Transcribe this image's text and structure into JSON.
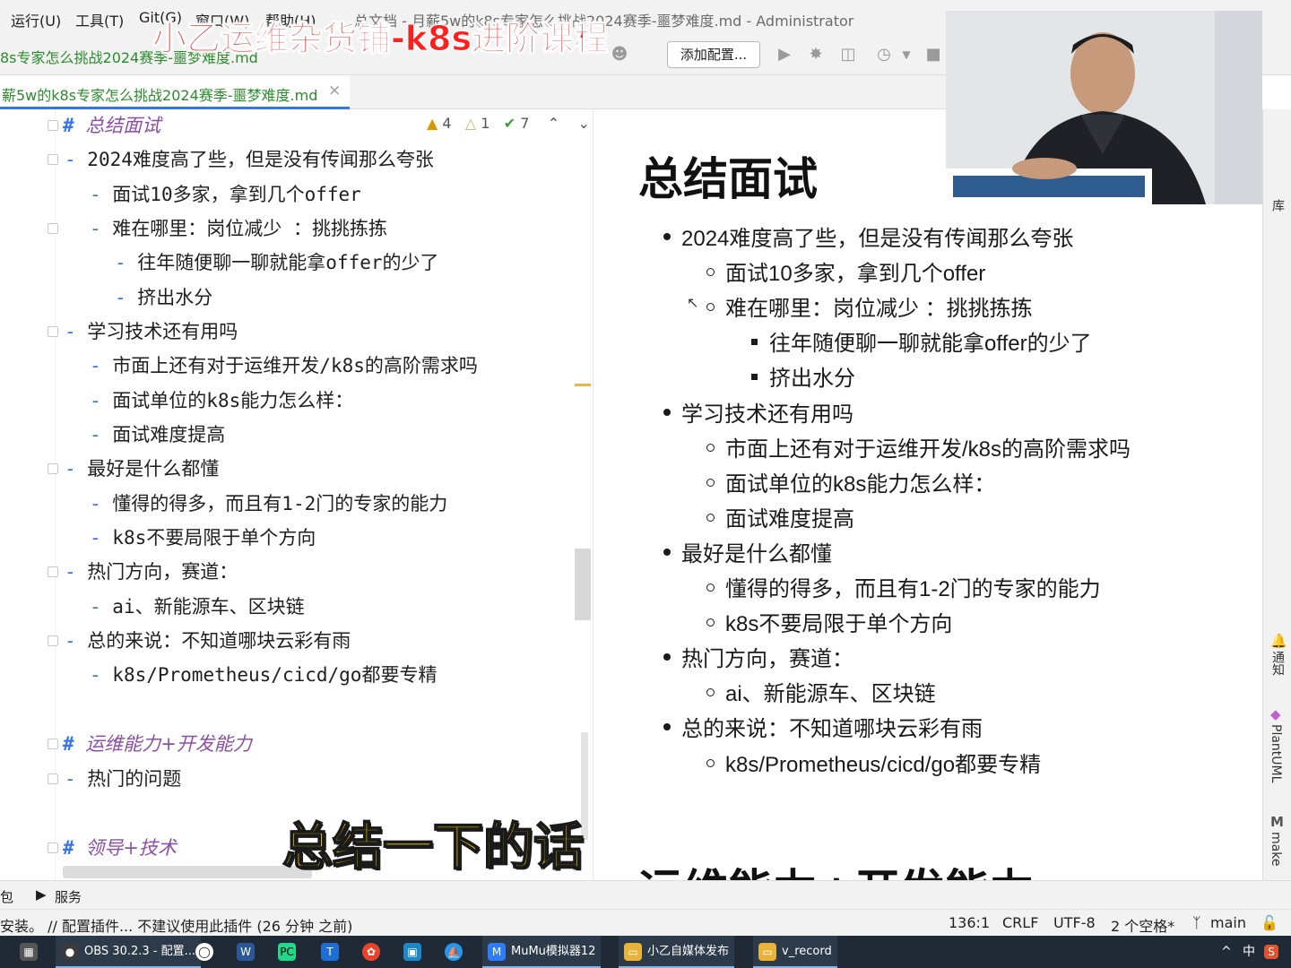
{
  "menubar": {
    "items": [
      "运行(U)",
      "工具(T)",
      "Git(G)",
      "窗口(W)",
      "帮助(H)"
    ],
    "window_title": "总文档 - 月薪5w的k8s专家怎么挑战2024赛季-噩梦难度.md - Administrator"
  },
  "toolbar": {
    "breadcrumb": "8s专家怎么挑战2024赛季-噩梦难度.md",
    "add_config_label": "添加配置...",
    "icons": [
      "run-icon",
      "debug-icon",
      "coverage-icon",
      "profile-icon",
      "stop-icon"
    ]
  },
  "tab": {
    "file_label": "薪5w的k8s专家怎么挑战2024赛季-噩梦难度.md",
    "close_glyph": "×"
  },
  "editor": {
    "inspections": {
      "warnings": "4",
      "weak_warnings": "1",
      "ok": "7"
    },
    "lines": [
      {
        "kind": "heading",
        "text": "总结面试"
      },
      {
        "kind": "item",
        "level": 0,
        "text": "2024难度高了些，但是没有传闻那么夸张"
      },
      {
        "kind": "item",
        "level": 1,
        "text": "面试10多家，拿到几个offer"
      },
      {
        "kind": "item",
        "level": 1,
        "text": "难在哪里：岗位减少 ：挑挑拣拣"
      },
      {
        "kind": "item",
        "level": 2,
        "text": "往年随便聊一聊就能拿offer的少了"
      },
      {
        "kind": "item",
        "level": 2,
        "text": "挤出水分"
      },
      {
        "kind": "item",
        "level": 0,
        "text": "学习技术还有用吗"
      },
      {
        "kind": "item",
        "level": 1,
        "text": "市面上还有对于运维开发/k8s的高阶需求吗"
      },
      {
        "kind": "item",
        "level": 1,
        "text": "面试单位的k8s能力怎么样："
      },
      {
        "kind": "item",
        "level": 1,
        "text": "面试难度提高"
      },
      {
        "kind": "item",
        "level": 0,
        "text": "最好是什么都懂"
      },
      {
        "kind": "item",
        "level": 1,
        "text": "懂得的得多，而且有1-2门的专家的能力"
      },
      {
        "kind": "item",
        "level": 1,
        "text": "k8s不要局限于单个方向"
      },
      {
        "kind": "item",
        "level": 0,
        "text": "热门方向，赛道："
      },
      {
        "kind": "item",
        "level": 1,
        "text": "ai、新能源车、区块链"
      },
      {
        "kind": "item",
        "level": 0,
        "text": "总的来说：不知道哪块云彩有雨"
      },
      {
        "kind": "item",
        "level": 1,
        "text": "k8s/Prometheus/cicd/go都要专精"
      },
      {
        "kind": "heading",
        "text": "运维能力+开发能力"
      },
      {
        "kind": "item",
        "level": 0,
        "text": "热门的问题"
      },
      {
        "kind": "heading",
        "text": "领导+技术"
      }
    ]
  },
  "preview": {
    "h1": "总结面试",
    "h1_next": "运维能力+开发能力",
    "items": [
      {
        "level": 0,
        "text": "2024难度高了些，但是没有传闻那么夸张"
      },
      {
        "level": 1,
        "text": "面试10多家，拿到几个offer"
      },
      {
        "level": 1,
        "text": "难在哪里：岗位减少 ：挑挑拣拣"
      },
      {
        "level": 2,
        "text": "往年随便聊一聊就能拿offer的少了"
      },
      {
        "level": 2,
        "text": "挤出水分"
      },
      {
        "level": 0,
        "text": "学习技术还有用吗"
      },
      {
        "level": 1,
        "text": "市面上还有对于运维开发/k8s的高阶需求吗"
      },
      {
        "level": 1,
        "text": "面试单位的k8s能力怎么样："
      },
      {
        "level": 1,
        "text": "面试难度提高"
      },
      {
        "level": 0,
        "text": "最好是什么都懂"
      },
      {
        "level": 1,
        "text": "懂得的得多，而且有1-2门的专家的能力"
      },
      {
        "level": 1,
        "text": "k8s不要局限于单个方向"
      },
      {
        "level": 0,
        "text": "热门方向，赛道："
      },
      {
        "level": 1,
        "text": "ai、新能源车、区块链"
      },
      {
        "level": 0,
        "text": "总的来说：不知道哪块云彩有雨"
      },
      {
        "level": 1,
        "text": "k8s/Prometheus/cicd/go都要专精"
      }
    ]
  },
  "right_strip": {
    "top_label": "库",
    "notifications_label": "通知",
    "plantuml_label": "PlantUML",
    "make_label": "make",
    "make_icon_glyph": "M"
  },
  "bottom_tabs": {
    "left_fragment": "包",
    "services_label": "服务"
  },
  "statusbar": {
    "message": "安装。 // 配置插件...   不建议使用此插件 (26 分钟 之前)",
    "position": "136:1",
    "line_sep": "CRLF",
    "encoding": "UTF-8",
    "indent": "2 个空格*",
    "branch": "main"
  },
  "taskbar": {
    "apps": [
      {
        "label": "OBS 30.2.3 - 配置...",
        "icon": "obs-icon",
        "color": "#3b3b3b"
      },
      {
        "label": "MuMu模拟器12",
        "icon": "mumu-icon",
        "color": "#2f7cf6"
      },
      {
        "label": "小乙自媒体发布",
        "icon": "folder-icon",
        "color": "#e8b33a"
      },
      {
        "label": "v_record",
        "icon": "folder-icon",
        "color": "#e8b33a"
      }
    ],
    "tray": {
      "ime": "中",
      "caret": "^"
    }
  },
  "overlays": {
    "title": "小乙运维杂货铺-k8s进阶课程",
    "subtitle": "总结一下的话",
    "title_color": "#ff1f1f",
    "subtitle_color": "#ffd400"
  }
}
